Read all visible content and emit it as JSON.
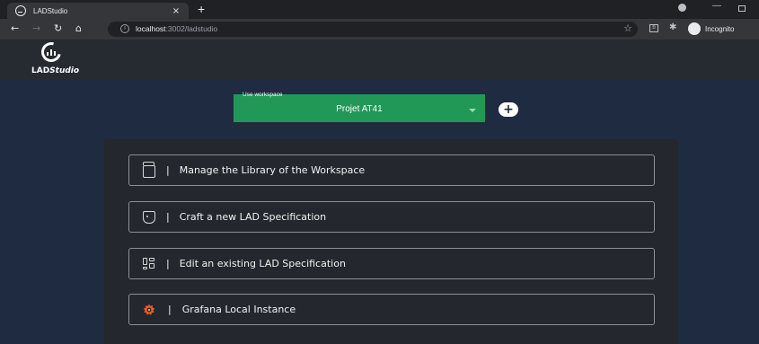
{
  "browser": {
    "tab_title": "LADStudio",
    "tab_close": "×",
    "new_tab": "+",
    "url_host": "localhost",
    "url_path": ":3002/ladstudio",
    "profile_label": "Incognito",
    "window_min": "—"
  },
  "app": {
    "logo_text_bold": "LAD",
    "logo_text_italic": "Studio"
  },
  "workspace": {
    "label": "Use workspace",
    "value": "Projet AT41",
    "add": "+"
  },
  "menu": {
    "separator": "|",
    "items": [
      {
        "label": "Manage the Library of the Workspace",
        "icon": "folder-icon"
      },
      {
        "label": "Craft a new LAD Specification",
        "icon": "shield-icon"
      },
      {
        "label": "Edit an existing LAD Specification",
        "icon": "dashboard-icon"
      },
      {
        "label": "Grafana Local Instance",
        "icon": "grafana-icon"
      }
    ]
  },
  "colors": {
    "page_bg": "#1f2b40",
    "header_bg": "#262a31",
    "panel_bg": "#24282e",
    "workspace_green": "#229856",
    "grafana_orange": "#f05a28"
  }
}
